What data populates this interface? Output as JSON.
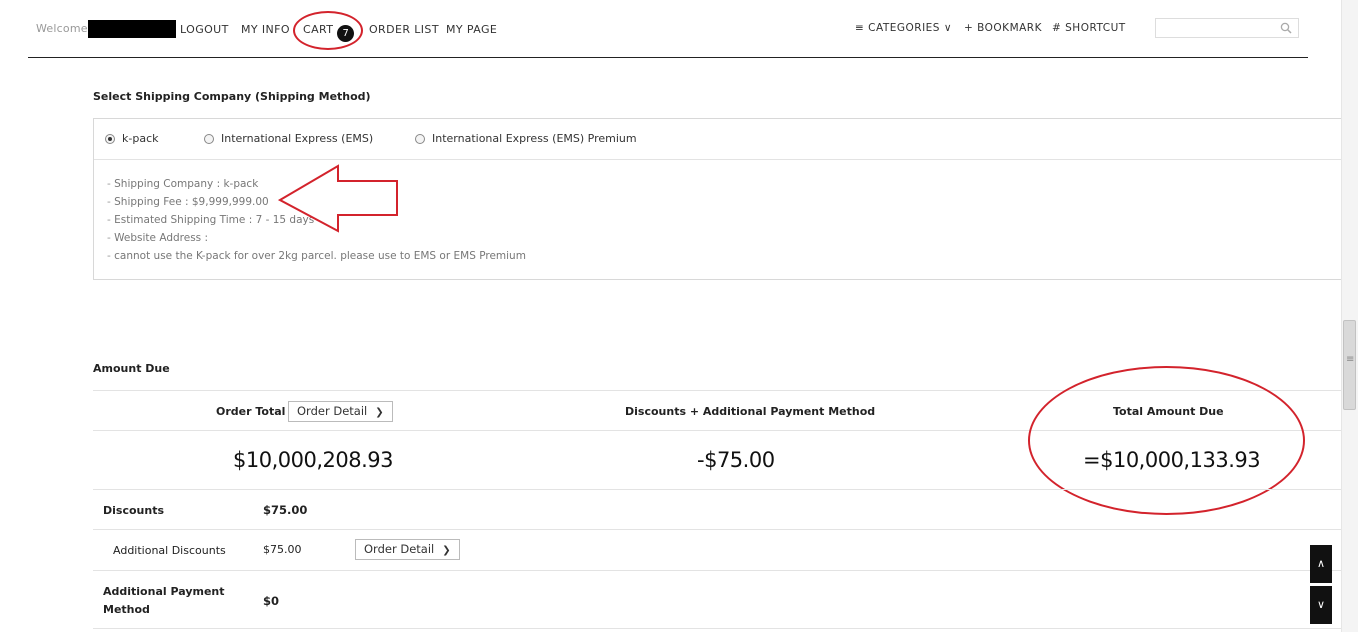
{
  "nav": {
    "welcome": "Welcome.",
    "logout": "LOGOUT",
    "my_info": "MY INFO",
    "cart": "CART",
    "cart_count": "7",
    "order_list": "ORDER LIST",
    "my_page": "MY PAGE",
    "categories": "≡ CATEGORIES ∨",
    "bookmark": "+ BOOKMARK",
    "shortcut": "# SHORTCUT",
    "search_placeholder": ""
  },
  "shipping": {
    "title": "Select Shipping Company (Shipping Method)",
    "options": [
      {
        "label": "k-pack",
        "selected": true
      },
      {
        "label": "International Express (EMS)",
        "selected": false
      },
      {
        "label": "International Express (EMS) Premium",
        "selected": false
      }
    ],
    "info": [
      "Shipping Company : k-pack",
      "Shipping Fee : $9,999,999.00",
      "Estimated Shipping Time : 7 - 15 days",
      "Website Address :",
      "cannot use the K-pack for over 2kg parcel. please use to EMS or EMS Premium"
    ]
  },
  "amount": {
    "title": "Amount Due",
    "order_total_label": "Order Total",
    "order_detail_btn": "Order Detail",
    "discounts_header": "Discounts + Additional Payment Method",
    "total_due_label": "Total Amount Due",
    "order_total": "$10,000,208.93",
    "discounts_total": "-$75.00",
    "total_due": "=$10,000,133.93",
    "rows": {
      "discounts_label": "Discounts",
      "discounts_value": "$75.00",
      "additional_discounts_label": "Additional Discounts",
      "additional_discounts_value": "$75.00",
      "additional_discounts_btn": "Order Detail",
      "additional_payment_label_1": "Additional Payment",
      "additional_payment_label_2": "Method",
      "additional_payment_value": "$0"
    }
  },
  "colors": {
    "annotation": "#d3232c",
    "badge": "#111111"
  },
  "icons": {
    "search": "search-icon",
    "scroll_up": "chevron-up-icon",
    "scroll_down": "chevron-down-icon"
  }
}
